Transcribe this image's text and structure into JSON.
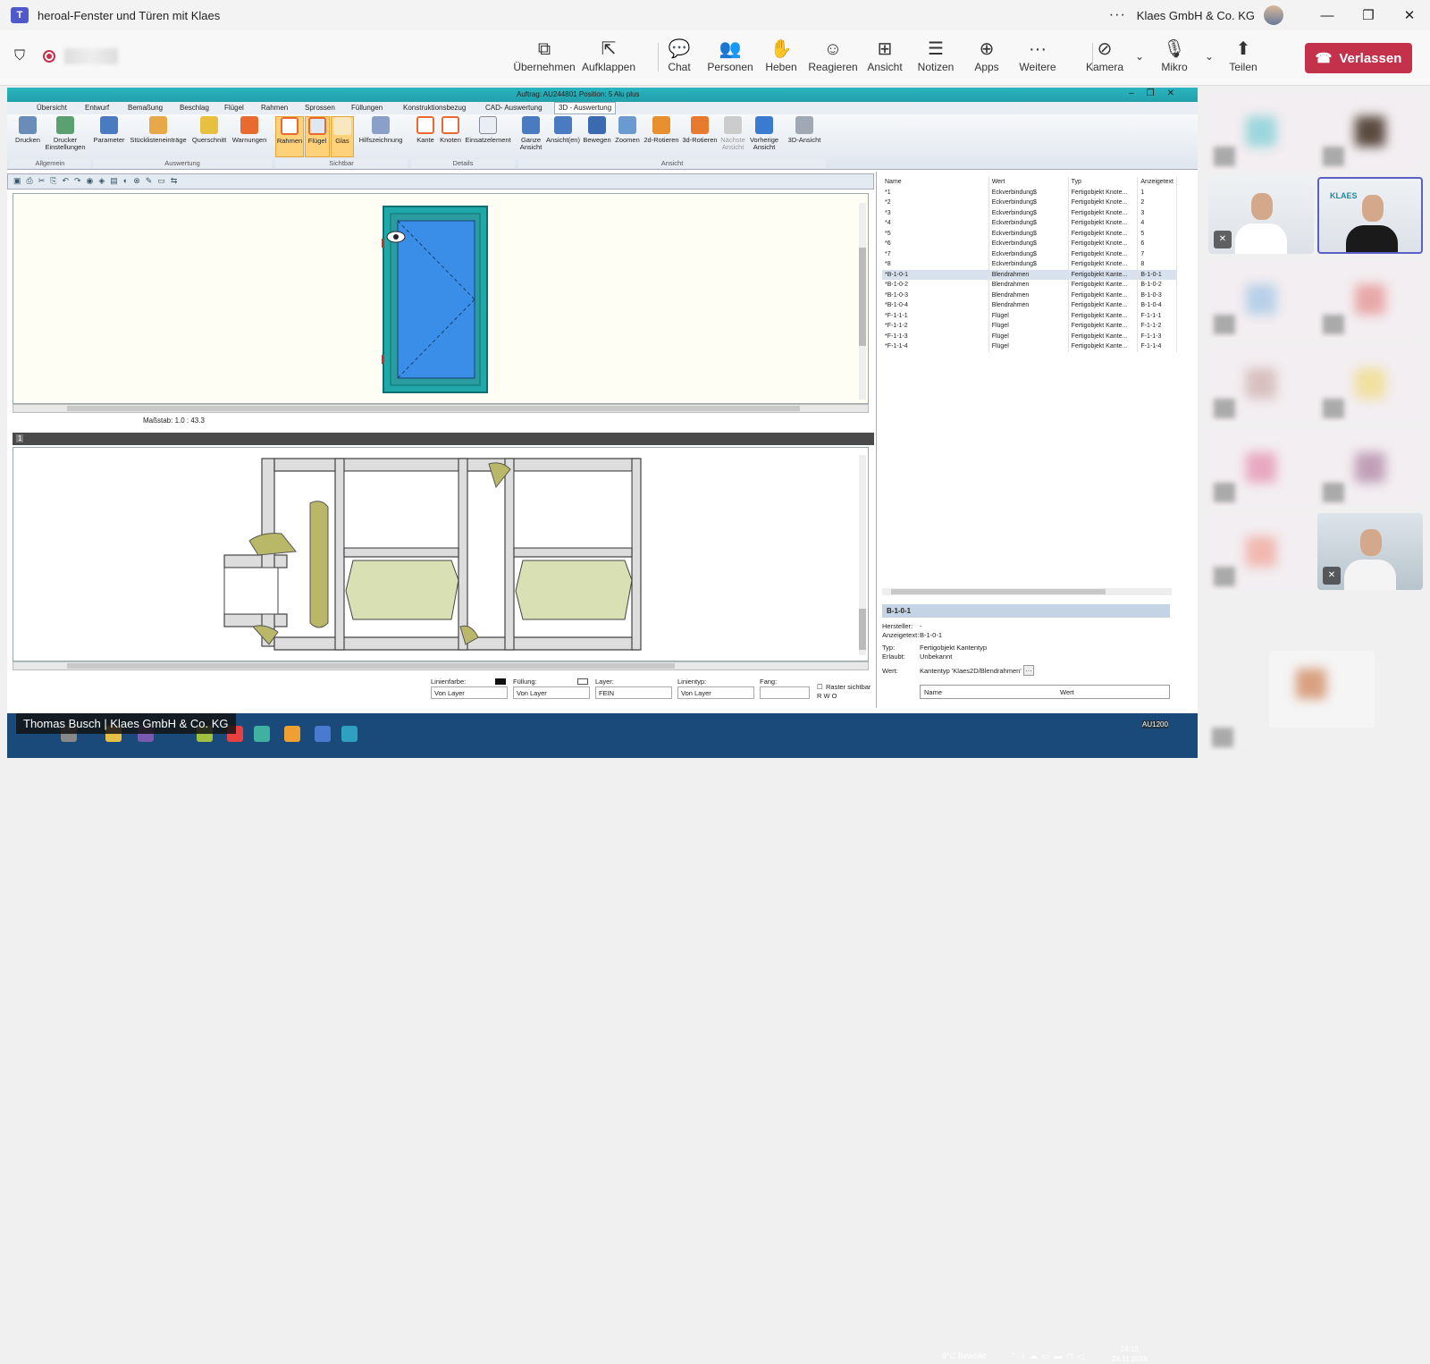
{
  "window": {
    "title": "heroal-Fenster und Türen mit Klaes",
    "org": "Klaes GmbH & Co. KG",
    "more": "···",
    "minimize": "—",
    "maximize": "❐",
    "close": "✕"
  },
  "meeting": {
    "tools": [
      {
        "label": "Übernehmen",
        "icon": "⧉"
      },
      {
        "label": "Aufklappen",
        "icon": "⇱"
      },
      {
        "label": "Chat",
        "icon": "💬"
      },
      {
        "label": "Personen",
        "icon": "👥"
      },
      {
        "label": "Heben",
        "icon": "✋"
      },
      {
        "label": "Reagieren",
        "icon": "☺"
      },
      {
        "label": "Ansicht",
        "icon": "⊞"
      },
      {
        "label": "Notizen",
        "icon": "☰"
      },
      {
        "label": "Apps",
        "icon": "⊕"
      },
      {
        "label": "Weitere",
        "icon": "···"
      },
      {
        "label": "Kamera",
        "icon": "⊘"
      },
      {
        "label": "Mikro",
        "icon": "🎙"
      },
      {
        "label": "Teilen",
        "icon": "⬆"
      }
    ],
    "leave_label": "Verlassen"
  },
  "app": {
    "title": "Auftrag: AU244801      Position: 5      Alu plus",
    "tabs": [
      "Übersicht",
      "Entwurf",
      "Bemaßung",
      "Beschlag",
      "Flügel",
      "Rahmen",
      "Sprossen",
      "Füllungen",
      "Konstruktionsbezug",
      "CAD- Auswertung",
      "3D - Auswertung"
    ],
    "ribbon": {
      "buttons": [
        "Drucken",
        "Drucker Einstellungen",
        "Parameter",
        "Stücklisteneinträge",
        "Querschnitt",
        "Warnungen",
        "Rahmen",
        "Flügel",
        "Glas",
        "Hilfszeichnung",
        "Kante",
        "Knoten",
        "Einsatzelement",
        "Ganze Ansicht",
        "Ansicht(en)",
        "Bewegen",
        "Zoomen",
        "2d-Rotieren",
        "3d-Rotieren",
        "Nächste Ansicht",
        "Vorherige Ansicht",
        "3D-Ansicht"
      ],
      "groups": [
        "Allgemein",
        "Auswertung",
        "Sichtbar",
        "Details",
        "Ansicht"
      ]
    },
    "scale_label": "Maßstab: 1.0 : 43.3",
    "split_label": "1",
    "props": [
      {
        "label": "Linienfarbe:",
        "value": "Von Layer"
      },
      {
        "label": "Füllung:",
        "value": "Von Layer"
      },
      {
        "label": "Layer:",
        "value": "FEIN"
      },
      {
        "label": "Linientyp:",
        "value": "Von Layer"
      },
      {
        "label": "Fang:",
        "value": ""
      }
    ],
    "raster_label": "Raster sichtbar",
    "raster_opts": "R  W  O",
    "table": {
      "headers": [
        "Name",
        "Wert",
        "Typ",
        "Anzeigetext"
      ],
      "rows": [
        [
          "*1",
          "Eckverbindung$",
          "Fertigobjekt Knote...",
          "1"
        ],
        [
          "*2",
          "Eckverbindung$",
          "Fertigobjekt Knote...",
          "2"
        ],
        [
          "*3",
          "Eckverbindung$",
          "Fertigobjekt Knote...",
          "3"
        ],
        [
          "*4",
          "Eckverbindung$",
          "Fertigobjekt Knote...",
          "4"
        ],
        [
          "*5",
          "Eckverbindung$",
          "Fertigobjekt Knote...",
          "5"
        ],
        [
          "*6",
          "Eckverbindung$",
          "Fertigobjekt Knote...",
          "6"
        ],
        [
          "*7",
          "Eckverbindung$",
          "Fertigobjekt Knote...",
          "7"
        ],
        [
          "*8",
          "Eckverbindung$",
          "Fertigobjekt Knote...",
          "8"
        ],
        [
          "*B-1-0-1",
          "Blendrahmen",
          "Fertigobjekt Kante...",
          "B-1-0-1"
        ],
        [
          "*B-1-0-2",
          "Blendrahmen",
          "Fertigobjekt Kante...",
          "B-1-0-2"
        ],
        [
          "*B-1-0-3",
          "Blendrahmen",
          "Fertigobjekt Kante...",
          "B-1-0-3"
        ],
        [
          "*B-1-0-4",
          "Blendrahmen",
          "Fertigobjekt Kante...",
          "B-1-0-4"
        ],
        [
          "*F-1-1-1",
          "Flügel",
          "Fertigobjekt Kante...",
          "F-1-1-1"
        ],
        [
          "*F-1-1-2",
          "Flügel",
          "Fertigobjekt Kante...",
          "F-1-1-2"
        ],
        [
          "*F-1-1-3",
          "Flügel",
          "Fertigobjekt Kante...",
          "F-1-1-3"
        ],
        [
          "*F-1-1-4",
          "Flügel",
          "Fertigobjekt Kante...",
          "F-1-1-4"
        ]
      ]
    },
    "detail": {
      "title": "B-1-0-1",
      "hersteller_label": "Hersteller:",
      "hersteller_value": "-",
      "anzeige_label": "Anzeigetext:",
      "anzeige_value": "B-1-0-1",
      "typ_label": "Typ:",
      "typ_value": "Fertigobjekt Kantentyp",
      "erlaubt_label": "Erlaubt:",
      "erlaubt_value": "Unbekannt",
      "wert_label": "Wert:",
      "wert_value": "Kantentyp 'Klaes2D/Blendrahmen'",
      "col_name": "Name",
      "col_wert": "Wert"
    },
    "status_right": "AU1200"
  },
  "taskbar": {
    "caption": "Thomas Busch | Klaes GmbH & Co. KG",
    "weather": "8°C  Bewölkt",
    "time": "14:13",
    "date": "28.11.2024"
  },
  "video": {
    "klaes_logo": "KLAES"
  }
}
